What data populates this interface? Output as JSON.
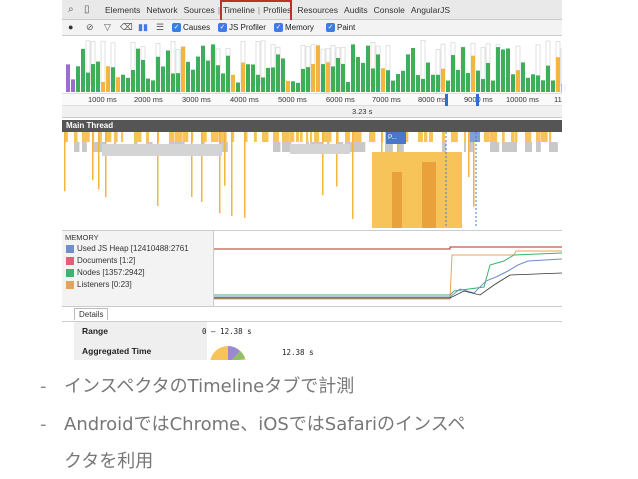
{
  "devtools": {
    "tabs": [
      "Elements",
      "Network",
      "Sources",
      "Timeline",
      "Profiles",
      "Resources",
      "Audits",
      "Console",
      "AngularJS"
    ],
    "active_tab": "Timeline",
    "toolbar": {
      "causes": "Causes",
      "js_profiler": "JS Profiler",
      "memory": "Memory",
      "paint": "Paint"
    },
    "ruler_ticks": [
      "1000 ms",
      "2000 ms",
      "3000 ms",
      "4000 ms",
      "5000 ms",
      "6000 ms",
      "7000 ms",
      "8000 ms",
      "9000 ms",
      "10000 ms",
      "11"
    ],
    "selection_duration": "3.23 s",
    "main_thread": "Main Thread",
    "flame_label": "P...",
    "memory": {
      "title": "MEMORY",
      "legend": [
        {
          "label": "Used JS Heap [12410488:2761",
          "color": "#6e8fc7"
        },
        {
          "label": "Documents [1:2]",
          "color": "#e0607a"
        },
        {
          "label": "Nodes [1357:2942]",
          "color": "#3cb371"
        },
        {
          "label": "Listeners [0:23]",
          "color": "#e5a45a"
        }
      ]
    },
    "details": {
      "tab": "Details",
      "range_label": "Range",
      "range_value": "0 – 12.38 s",
      "aggregated_label": "Aggregated Time",
      "aggregated_value": "12.38 s"
    }
  },
  "bullets": [
    "インスペクタのTimelineタブで計測",
    "AndroidではChrome、iOSではSafariのインスペ",
    "クタを利用"
  ],
  "bullet_marker": "-"
}
